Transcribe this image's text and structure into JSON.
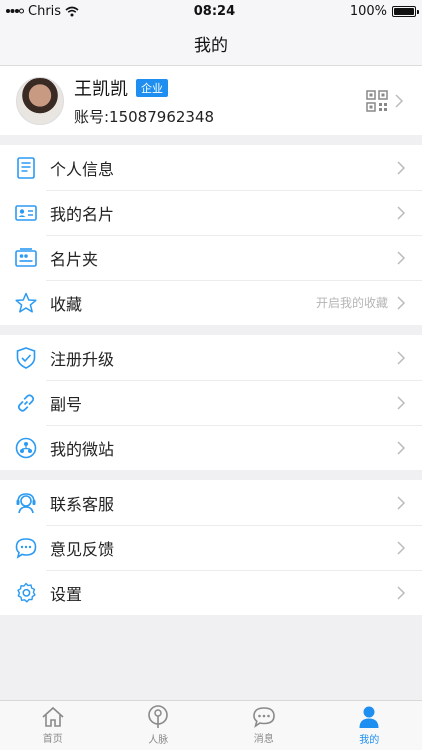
{
  "status": {
    "carrier": "Chris",
    "time": "08:24",
    "battery": "100%"
  },
  "nav": {
    "title": "我的"
  },
  "profile": {
    "name": "王凯凯",
    "badge": "企业",
    "account": "账号:15087962348"
  },
  "groups": [
    [
      {
        "label": "个人信息",
        "icon": "document-icon"
      },
      {
        "label": "我的名片",
        "icon": "business-card-icon"
      },
      {
        "label": "名片夹",
        "icon": "card-holder-icon"
      },
      {
        "label": "收藏",
        "icon": "star-icon",
        "extra": "开启我的收藏"
      }
    ],
    [
      {
        "label": "注册升级",
        "icon": "shield-icon"
      },
      {
        "label": "副号",
        "icon": "link-icon"
      },
      {
        "label": "我的微站",
        "icon": "site-icon"
      }
    ],
    [
      {
        "label": "联系客服",
        "icon": "headset-icon"
      },
      {
        "label": "意见反馈",
        "icon": "chat-icon"
      },
      {
        "label": "设置",
        "icon": "gear-icon"
      }
    ]
  ],
  "tabs": [
    {
      "label": "首页",
      "icon": "home-icon"
    },
    {
      "label": "人脉",
      "icon": "contacts-icon"
    },
    {
      "label": "消息",
      "icon": "message-icon"
    },
    {
      "label": "我的",
      "icon": "profile-icon",
      "active": true
    }
  ],
  "colors": {
    "accent": "#1e8ff0",
    "background": "#f0f0f2"
  }
}
